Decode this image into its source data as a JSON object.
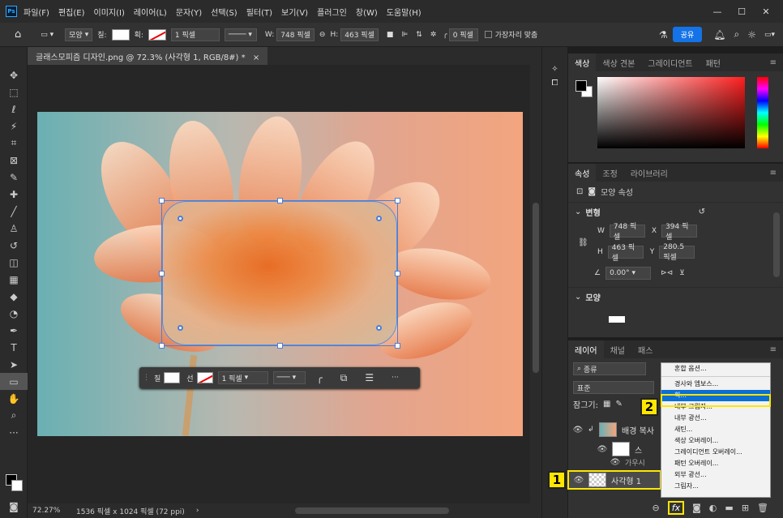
{
  "menu": {
    "logo": "Ps",
    "items": [
      "파일(F)",
      "편집(E)",
      "이미지(I)",
      "레이어(L)",
      "문자(Y)",
      "선택(S)",
      "필터(T)",
      "보기(V)",
      "플러그인",
      "창(W)",
      "도움말(H)"
    ],
    "minimize": "—",
    "maximize": "☐",
    "close": "✕"
  },
  "options": {
    "shape_label": "모양",
    "fill_label": "칠:",
    "stroke_label": "획:",
    "stroke_width": "1 픽셀",
    "w_label": "W:",
    "w_value": "748 픽셀",
    "h_label": "H:",
    "h_value": "463 픽셀",
    "radius": "0 픽셀",
    "align_edges": "가장자리 맞춤",
    "share": "공유"
  },
  "document": {
    "tab_title": "글래스모피즘 디자인.png @ 72.3% (사각형 1, RGB/8#) *",
    "close": "×"
  },
  "context_bar": {
    "fill": "칠",
    "stroke": "선",
    "stroke_width": "1 픽셀",
    "more": "···"
  },
  "status": {
    "zoom": "72.27%",
    "info": "1536 픽셀 x 1024 픽셀 (72 ppi)"
  },
  "color_panel": {
    "tabs": [
      "색상",
      "색상 견본",
      "그레이디언트",
      "패턴"
    ]
  },
  "props_panel": {
    "tabs": [
      "속성",
      "조정",
      "라이브러리"
    ],
    "shape_props": "모양 속성",
    "transform": "변형",
    "w_label": "W",
    "w_value": "748 픽셀",
    "x_label": "X",
    "x_value": "394 픽셀",
    "h_label": "H",
    "h_value": "463 픽셀",
    "y_label": "Y",
    "y_value": "280.5 픽셀",
    "angle": "0.00°",
    "shape_section": "모양"
  },
  "layers_panel": {
    "tabs": [
      "레이어",
      "채널",
      "패스"
    ],
    "search": "종류",
    "blend": "표준",
    "lock_label": "잠그기:",
    "layers": [
      {
        "name": "배경 복사"
      },
      {
        "name": "스"
      },
      {
        "name": "가우시"
      },
      {
        "name": "사각형 1"
      }
    ]
  },
  "fx_menu": {
    "items": [
      "혼합 옵션...",
      "경사와 엠보스...",
      "획...",
      "내부 그림자...",
      "내부 광선...",
      "새틴...",
      "색상 오버레이...",
      "그레이디언트 오버레이...",
      "패턴 오버레이...",
      "외부 광선...",
      "그림자..."
    ],
    "selected": "획..."
  },
  "annotations": {
    "badge1": "1",
    "badge2": "2"
  },
  "fx_button": "fx"
}
